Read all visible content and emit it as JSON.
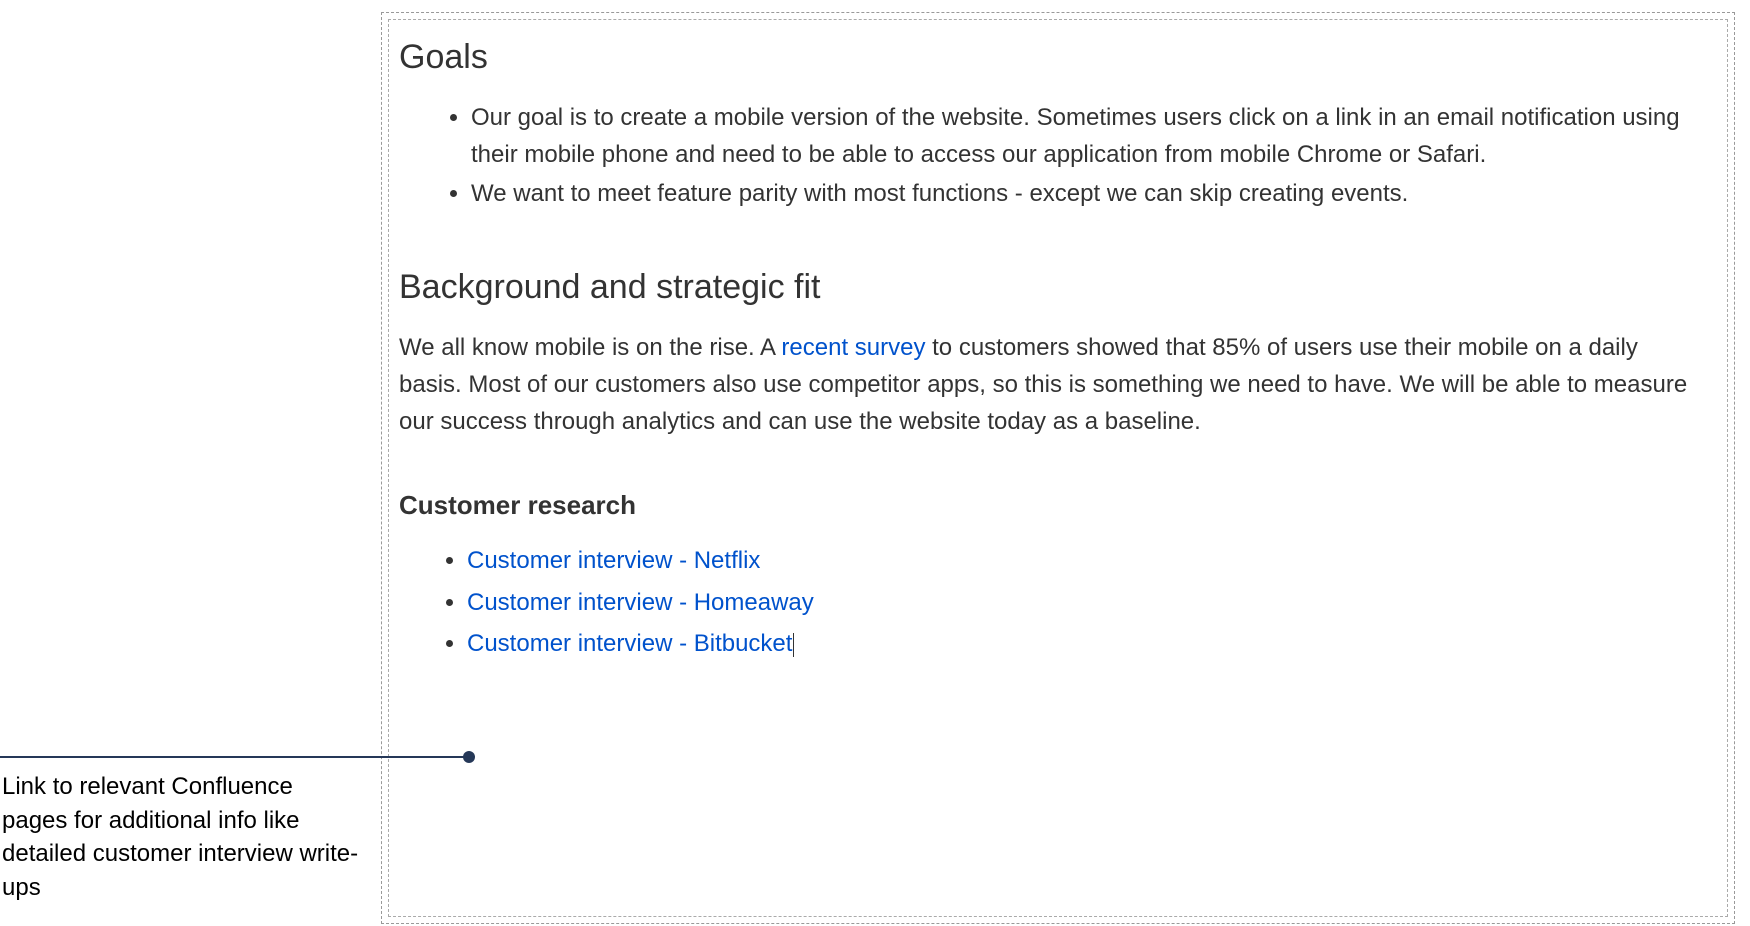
{
  "sections": {
    "goals": {
      "heading": "Goals",
      "bullets": [
        "Our goal is to create a mobile version of the website. Sometimes users click on a link in an email notification using their mobile phone and need to be able to access our application from mobile Chrome or Safari.",
        "We want to meet feature parity with most functions - except we can skip creating events."
      ]
    },
    "background": {
      "heading": "Background and strategic fit",
      "text_before_link": "We all know mobile is on the rise. A ",
      "link_text": "recent survey",
      "text_after_link": " to customers showed that 85% of users use their mobile on a daily basis. Most of our customers also use competitor apps, so this is something we need to have. We will be able to measure our success through analytics and can use the website today as a baseline."
    },
    "research": {
      "heading": "Customer research",
      "links": [
        "Customer interview - Netflix",
        "Customer interview - Homeaway",
        "Customer interview - Bitbucket"
      ]
    }
  },
  "annotation": "Link to relevant Confluence pages for additional info like detailed customer interview write-ups"
}
